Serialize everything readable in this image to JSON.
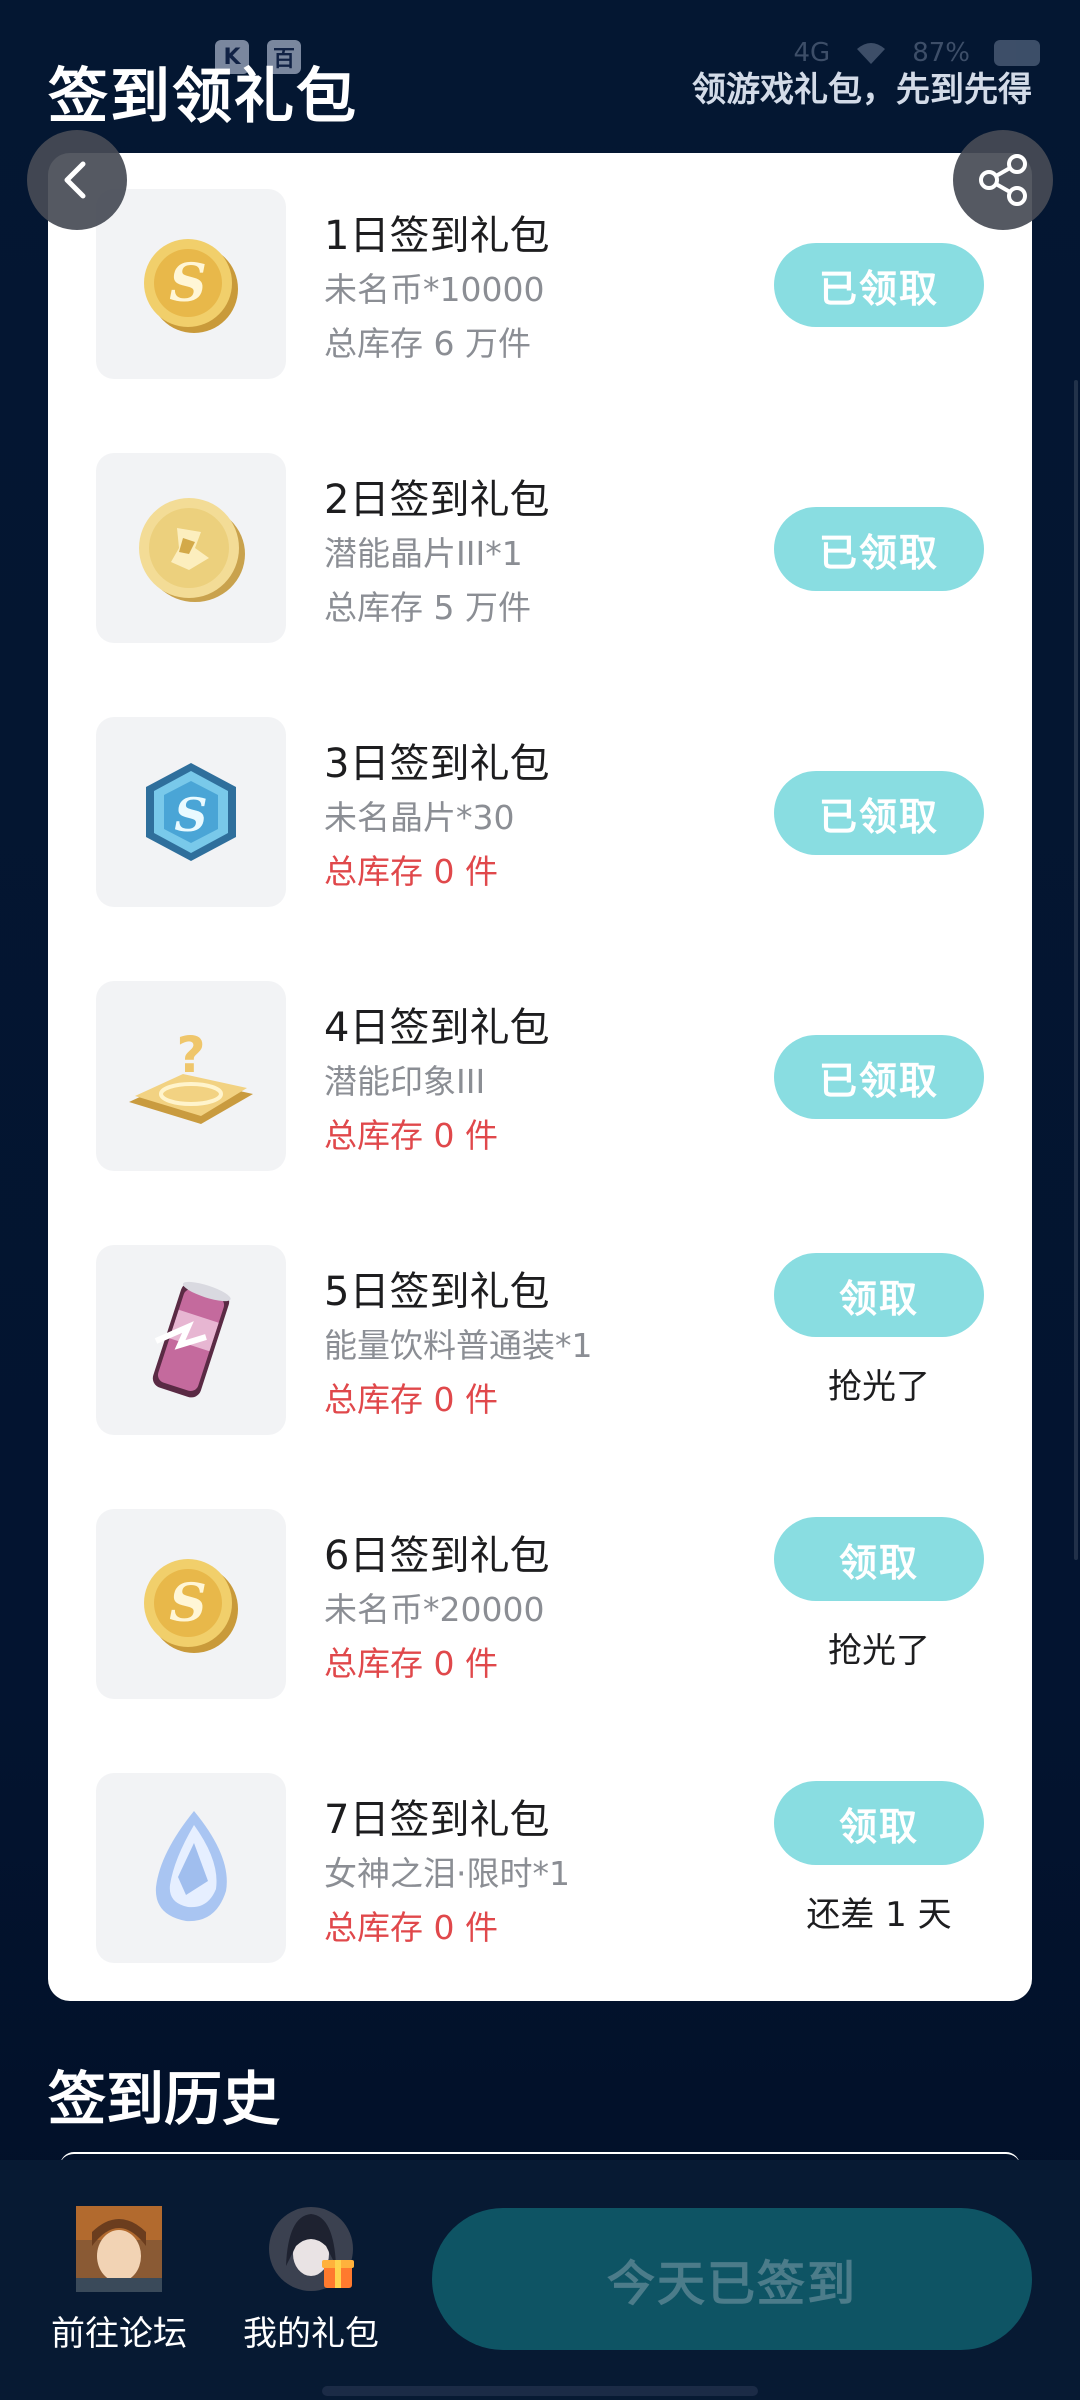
{
  "status_bar": {
    "app_icons": [
      "K",
      "百"
    ],
    "signal_text": "4G",
    "battery_text": "87%"
  },
  "header": {
    "title": "签到领礼包",
    "subtitle": "领游戏礼包，先到先得"
  },
  "gifts": [
    {
      "title": "1日签到礼包",
      "content": "未名币*10000",
      "stock": "总库存 6 万件",
      "button": "已领取",
      "note": "",
      "icon": "gold-coin-icon"
    },
    {
      "title": "2日签到礼包",
      "content": "潜能晶片III*1",
      "stock": "总库存 5 万件",
      "button": "已领取",
      "note": "",
      "icon": "gold-chip-coin-icon"
    },
    {
      "title": "3日签到礼包",
      "content": "未名晶片*30",
      "stock": "总库存 0 件",
      "button": "已领取",
      "note": "",
      "icon": "blue-hexagon-chip-icon"
    },
    {
      "title": "4日签到礼包",
      "content": "潜能印象III",
      "stock": "总库存 0 件",
      "button": "已领取",
      "note": "",
      "icon": "golden-question-plate-icon"
    },
    {
      "title": "5日签到礼包",
      "content": "能量饮料普通装*1",
      "stock": "总库存 0 件",
      "button": "领取",
      "note": "抢光了",
      "icon": "energy-drink-can-icon"
    },
    {
      "title": "6日签到礼包",
      "content": "未名币*20000",
      "stock": "总库存 0 件",
      "button": "领取",
      "note": "抢光了",
      "icon": "gold-coin-icon"
    },
    {
      "title": "7日签到礼包",
      "content": "女神之泪·限时*1",
      "stock": "总库存 0 件",
      "button": "领取",
      "note": "还差 1 天",
      "icon": "crystal-tear-icon"
    }
  ],
  "history": {
    "title": "签到历史"
  },
  "bottom_bar": {
    "forum_label": "前往论坛",
    "my_gifts_label": "我的礼包",
    "signed_button": "今天已签到"
  },
  "colors": {
    "background": "#031634",
    "button_teal": "#89dde1",
    "stock_empty_red": "#e0484b",
    "signed_button_bg": "#0e5464"
  }
}
